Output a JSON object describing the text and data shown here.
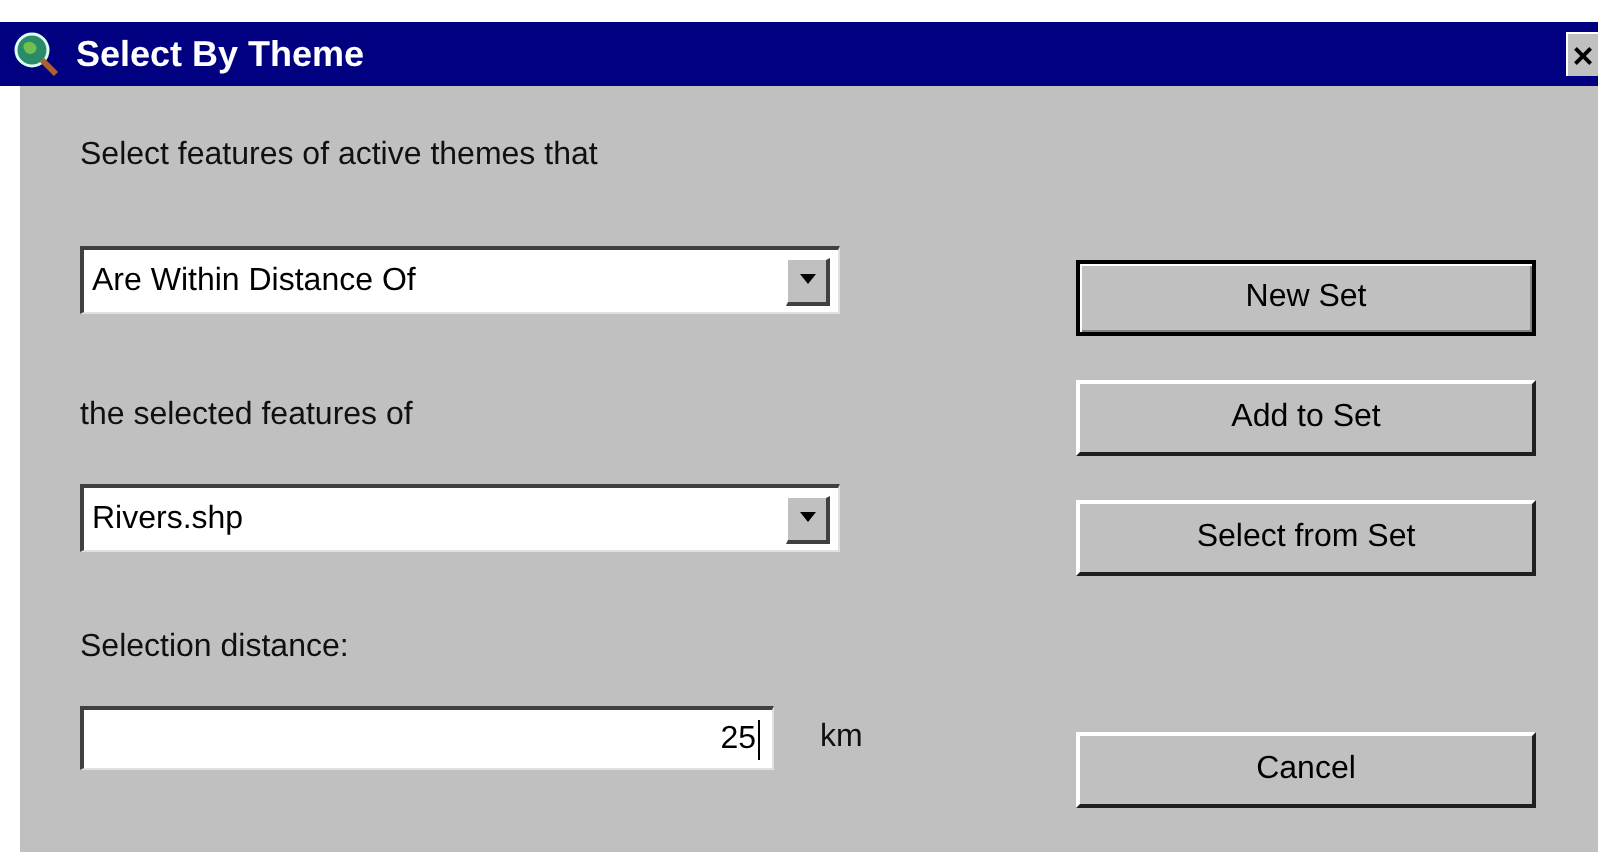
{
  "window": {
    "title": "Select By Theme",
    "close": "×"
  },
  "prompt": "Select features of active themes that",
  "relation": {
    "value": "Are Within Distance Of"
  },
  "theme_label": "the selected features of",
  "theme": {
    "value": "Rivers.shp"
  },
  "distance_label": "Selection distance:",
  "distance": {
    "value": "25",
    "unit": "km"
  },
  "buttons": [
    {
      "label": "New Set",
      "default": true
    },
    {
      "label": "Add to Set",
      "default": false
    },
    {
      "label": "Select from Set",
      "default": false
    },
    {
      "label": "Cancel",
      "default": false
    }
  ]
}
